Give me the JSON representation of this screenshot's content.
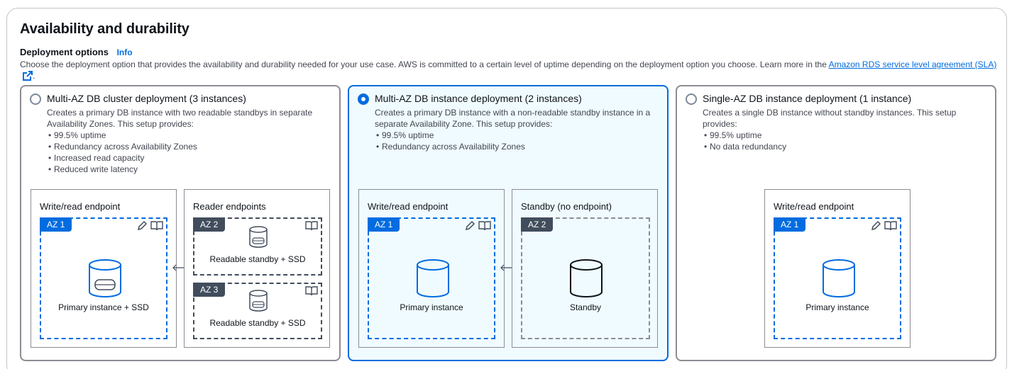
{
  "section": {
    "title": "Availability and durability",
    "field_label": "Deployment options",
    "info_link": "Info",
    "description": "Choose the deployment option that provides the availability and durability needed for your use case. AWS is committed to a certain level of uptime depending on the deployment option you choose. Learn more in the",
    "sla_link": "Amazon RDS service level agreement (SLA)",
    "description_end": "."
  },
  "options": [
    {
      "title": "Multi-AZ DB cluster deployment (3 instances)",
      "selected": false,
      "description": "Creates a primary DB instance with two readable standbys in separate Availability Zones. This setup provides:",
      "bullets": [
        "99.5% uptime",
        "Redundancy across Availability Zones",
        "Increased read capacity",
        "Reduced write latency"
      ],
      "endpoint_left": "Write/read endpoint",
      "endpoint_right": "Reader endpoints",
      "az1": {
        "tag": "AZ 1",
        "caption": "Primary instance + SSD"
      },
      "az2": {
        "tag": "AZ 2",
        "caption": "Readable standby + SSD"
      },
      "az3": {
        "tag": "AZ 3",
        "caption": "Readable standby + SSD"
      }
    },
    {
      "title": "Multi-AZ DB instance deployment (2 instances)",
      "selected": true,
      "description": "Creates a primary DB instance with a non-readable standby instance in a separate Availability Zone. This setup provides:",
      "bullets": [
        "99.5% uptime",
        "Redundancy across Availability Zones"
      ],
      "endpoint_left": "Write/read endpoint",
      "endpoint_right": "Standby (no endpoint)",
      "az1": {
        "tag": "AZ 1",
        "caption": "Primary instance"
      },
      "az2": {
        "tag": "AZ 2",
        "caption": "Standby"
      }
    },
    {
      "title": "Single-AZ DB instance deployment (1 instance)",
      "selected": false,
      "description": "Creates a single DB instance without standby instances. This setup provides:",
      "bullets": [
        "99.5% uptime",
        "No data redundancy"
      ],
      "endpoint_left": "Write/read endpoint",
      "az1": {
        "tag": "AZ 1",
        "caption": "Primary instance"
      }
    }
  ],
  "colors": {
    "accent": "#006ce0",
    "selected_bg": "#f0fbff",
    "dark_tag": "#414d5c",
    "border": "#8c8c94"
  },
  "icons": [
    "external-link-icon",
    "pencil-icon",
    "book-icon",
    "database-icon",
    "double-arrow-icon"
  ]
}
